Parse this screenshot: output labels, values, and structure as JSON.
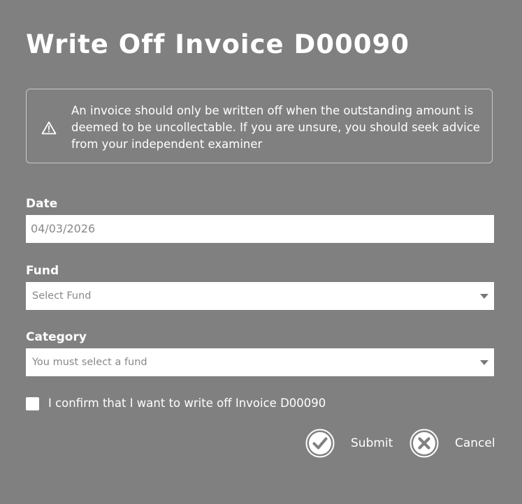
{
  "dialog": {
    "title": "Write Off Invoice D00090",
    "warning": {
      "icon": "warning-triangle-icon",
      "text": "An invoice should only be written off when the outstanding amount is deemed to be uncollectable. If you are unsure, you should seek advice from your independent examiner"
    },
    "fields": {
      "date": {
        "label": "Date",
        "value": "04/03/2026"
      },
      "fund": {
        "label": "Fund",
        "placeholder": "Select Fund"
      },
      "category": {
        "label": "Category",
        "placeholder": "You must select a fund"
      }
    },
    "confirm": {
      "label": "I confirm that I want to write off Invoice D00090",
      "checked": false
    },
    "actions": {
      "submit": {
        "label": "Submit",
        "icon": "check-circle-icon"
      },
      "cancel": {
        "label": "Cancel",
        "icon": "x-circle-icon"
      }
    }
  },
  "colors": {
    "background": "#808080",
    "text": "#ffffff",
    "input_background": "#ffffff",
    "input_text": "#888888"
  }
}
